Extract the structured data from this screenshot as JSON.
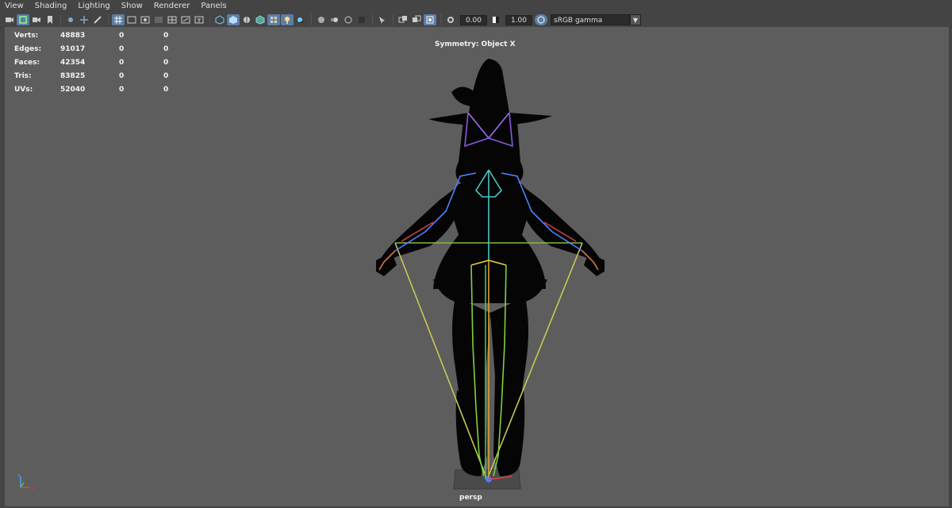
{
  "menu": [
    "View",
    "Shading",
    "Lighting",
    "Show",
    "Renderer",
    "Panels"
  ],
  "toolbar": {
    "exposure_value": "0.00",
    "gamma_value": "1.00",
    "color_space": "sRGB gamma"
  },
  "hud": {
    "rows": [
      {
        "label": "Verts:",
        "total": "48883",
        "sel1": "0",
        "sel2": "0"
      },
      {
        "label": "Edges:",
        "total": "91017",
        "sel1": "0",
        "sel2": "0"
      },
      {
        "label": "Faces:",
        "total": "42354",
        "sel1": "0",
        "sel2": "0"
      },
      {
        "label": "Tris:",
        "total": "83825",
        "sel1": "0",
        "sel2": "0"
      },
      {
        "label": "UVs:",
        "total": "52040",
        "sel1": "0",
        "sel2": "0"
      }
    ]
  },
  "viewport": {
    "symmetry": "Symmetry: Object X",
    "camera": "persp"
  },
  "colors": {
    "viewport_bg": "#5d5d5d",
    "ui_bg": "#444444",
    "accent": "#5c7ea3"
  }
}
